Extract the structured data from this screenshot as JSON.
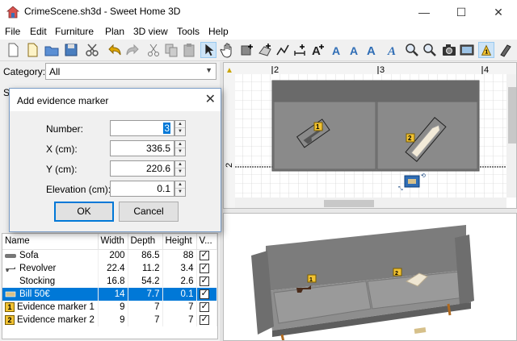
{
  "window": {
    "title": "CrimeScene.sh3d - Sweet Home 3D",
    "minimize": "—",
    "maximize": "☐",
    "close": "✕"
  },
  "menu": [
    "File",
    "Edit",
    "Furniture",
    "Plan",
    "3D view",
    "Tools",
    "Help"
  ],
  "catalog": {
    "category_label": "Category:",
    "category_value": "All",
    "search_label": "Se"
  },
  "plan": {
    "ruler_top": [
      "2",
      "3",
      "4"
    ],
    "ruler_left": [
      "2"
    ],
    "marker1": "1",
    "marker2": "2"
  },
  "view3d": {
    "marker1": "1",
    "marker2": "2"
  },
  "dialog": {
    "title": "Add evidence marker",
    "number_label": "Number:",
    "number_value": "3",
    "x_label": "X (cm):",
    "x_value": "336.5",
    "y_label": "Y (cm):",
    "y_value": "220.6",
    "elev_label": "Elevation (cm):",
    "elev_value": "0.1",
    "ok": "OK",
    "cancel": "Cancel"
  },
  "table": {
    "headers": [
      "Name",
      "Width",
      "Depth",
      "Height",
      "V..."
    ],
    "rows": [
      {
        "name": "Sofa",
        "width": "200",
        "depth": "86.5",
        "height": "88",
        "icon": "sofa-icon"
      },
      {
        "name": "Revolver",
        "width": "22.4",
        "depth": "11.2",
        "height": "3.4",
        "icon": "revolver-icon"
      },
      {
        "name": "Stocking",
        "width": "16.8",
        "depth": "54.2",
        "height": "2.6",
        "icon": "stocking-icon"
      },
      {
        "name": "Bill 50€",
        "width": "14",
        "depth": "7.7",
        "height": "0.1",
        "icon": "banknote-icon",
        "selected": true
      },
      {
        "name": "Evidence marker 1",
        "width": "9",
        "depth": "7",
        "height": "7",
        "badge": "1"
      },
      {
        "name": "Evidence marker 2",
        "width": "9",
        "depth": "7",
        "height": "7",
        "badge": "2"
      }
    ]
  },
  "colors": {
    "selection": "#0078d7",
    "marker": "#f1c232",
    "sofa": "#7a7a7a"
  }
}
